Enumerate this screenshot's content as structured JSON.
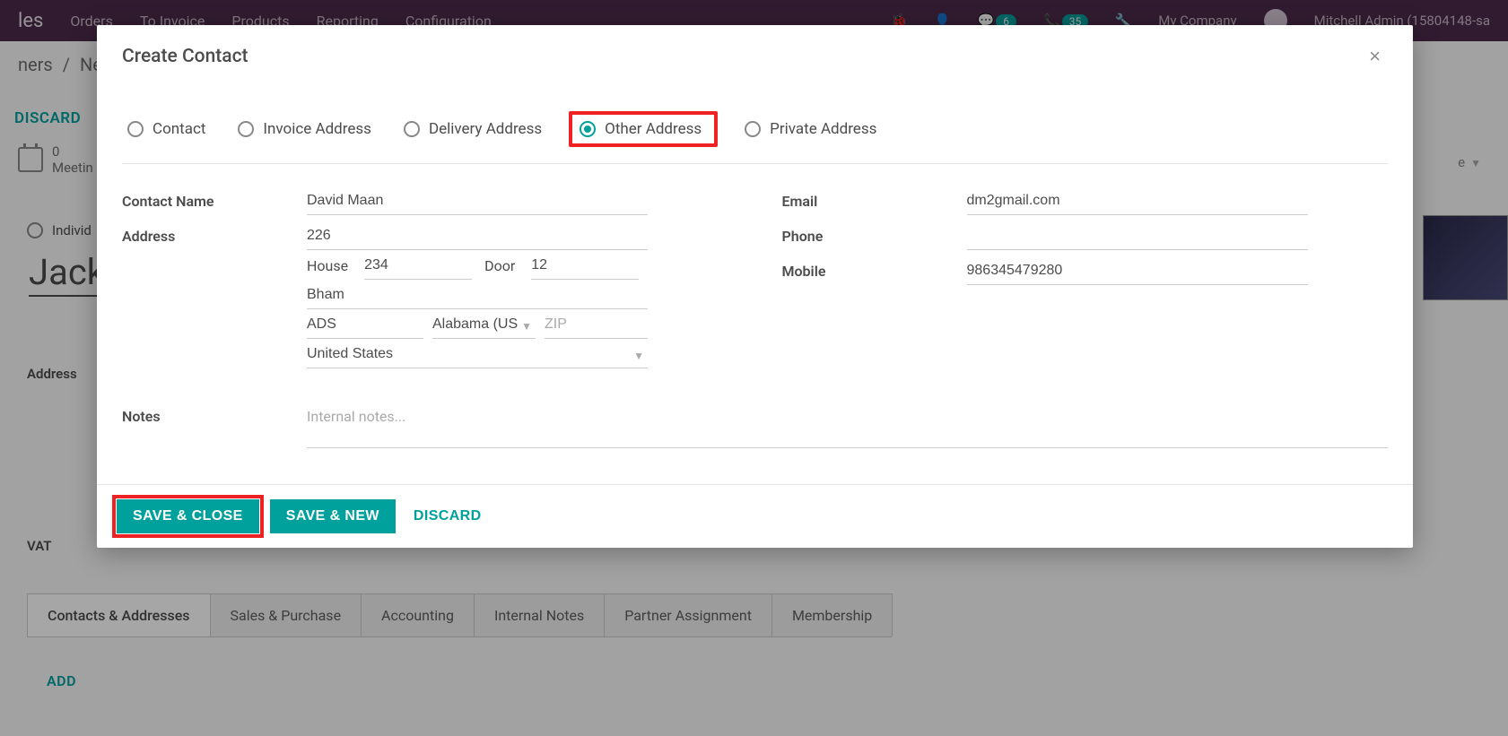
{
  "topnav": {
    "brand": "les",
    "items": [
      "Orders",
      "To Invoice",
      "Products",
      "Reporting",
      "Configuration"
    ],
    "badge1": "6",
    "badge2": "35",
    "company": "My Company",
    "user": "Mitchell Admin (15804148-sa"
  },
  "background": {
    "breadcrumb_left": "ners",
    "breadcrumb_sep": "/",
    "breadcrumb_right": "New",
    "discard": "DISCARD",
    "meetings_count": "0",
    "meetings_label": "Meetin",
    "individual": "Individ",
    "name": "Jack",
    "address_label": "Address",
    "vat_label": "VAT",
    "add": "ADD",
    "e_dropdown": "e",
    "tabs": [
      "Contacts & Addresses",
      "Sales & Purchase",
      "Accounting",
      "Internal Notes",
      "Partner Assignment",
      "Membership"
    ]
  },
  "modal": {
    "title": "Create Contact",
    "close": "×",
    "radios": [
      {
        "label": "Contact",
        "selected": false
      },
      {
        "label": "Invoice Address",
        "selected": false
      },
      {
        "label": "Delivery Address",
        "selected": false
      },
      {
        "label": "Other Address",
        "selected": true,
        "highlight": true
      },
      {
        "label": "Private Address",
        "selected": false
      }
    ],
    "labels": {
      "contact_name": "Contact Name",
      "address": "Address",
      "house": "House",
      "door": "Door",
      "zip_placeholder": "ZIP",
      "email": "Email",
      "phone": "Phone",
      "mobile": "Mobile",
      "notes": "Notes",
      "notes_placeholder": "Internal notes..."
    },
    "values": {
      "contact_name": "David Maan",
      "street": "226",
      "house": "234",
      "door": "12",
      "street2": "Bham",
      "city": "ADS",
      "state": "Alabama (US",
      "zip": "",
      "country": "United States",
      "email": "dm2gmail.com",
      "phone": "",
      "mobile": "986345479280",
      "notes": ""
    },
    "footer": {
      "save_close": "SAVE & CLOSE",
      "save_new": "SAVE & NEW",
      "discard": "DISCARD"
    }
  }
}
